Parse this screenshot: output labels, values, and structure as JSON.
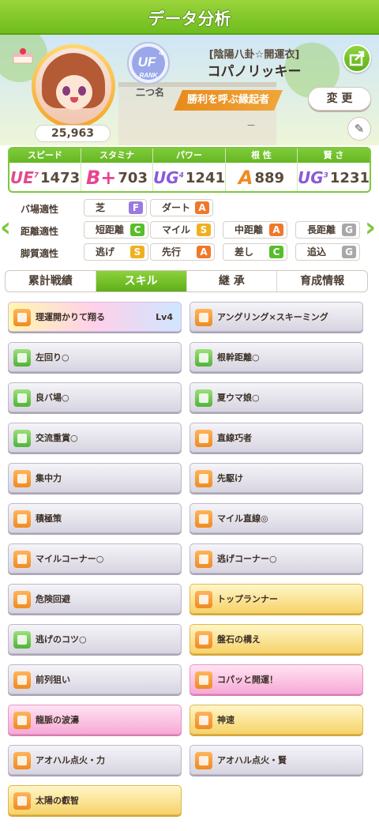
{
  "header": {
    "title": "データ分析"
  },
  "profile": {
    "score": "25,963",
    "rank_label": "RANK",
    "rank_grade": "UF",
    "rank_sub": "4",
    "epithet_label": "二つ名",
    "outfit": "[陰陽八卦☆開運衣]",
    "name": "コパノリッキー",
    "title_badge": "勝利を呼ぶ縁起者",
    "change_label": "変 更",
    "dash": "－"
  },
  "stats": [
    {
      "label": "スピード",
      "grade": "UE",
      "grade_sub": "7",
      "value": "1473",
      "color": "#e04b8a"
    },
    {
      "label": "スタミナ",
      "grade": "B+",
      "grade_sub": "",
      "value": "703",
      "color": "#e8458f"
    },
    {
      "label": "パワー",
      "grade": "UG",
      "grade_sub": "4",
      "value": "1241",
      "color": "#8a5ad8"
    },
    {
      "label": "根 性",
      "grade": "A",
      "grade_sub": "",
      "value": "889",
      "color": "#f08a22"
    },
    {
      "label": "賢 さ",
      "grade": "UG",
      "grade_sub": "3",
      "value": "1231",
      "color": "#8a5ad8"
    }
  ],
  "aptitude": {
    "rows": [
      {
        "label": "バ場適性",
        "items": [
          {
            "name": "芝",
            "grade": "F"
          },
          {
            "name": "ダート",
            "grade": "A"
          }
        ]
      },
      {
        "label": "距離適性",
        "items": [
          {
            "name": "短距離",
            "grade": "C"
          },
          {
            "name": "マイル",
            "grade": "S"
          },
          {
            "name": "中距離",
            "grade": "A"
          },
          {
            "name": "長距離",
            "grade": "G"
          }
        ]
      },
      {
        "label": "脚質適性",
        "items": [
          {
            "name": "逃げ",
            "grade": "S"
          },
          {
            "name": "先行",
            "grade": "A"
          },
          {
            "name": "差し",
            "grade": "C"
          },
          {
            "name": "追込",
            "grade": "G"
          }
        ]
      }
    ],
    "grade_colors": {
      "S": "#f0b01e",
      "A": "#f0782a",
      "C": "#56be2a",
      "F": "#9a7ae0",
      "G": "#a8a8a8"
    }
  },
  "tabs": [
    "累計戦績",
    "スキル",
    "継 承",
    "育成情報"
  ],
  "active_tab": 1,
  "skills": [
    {
      "name": "理運開かりて翔る",
      "level": "Lv4",
      "style": "rainbow",
      "icon": "o"
    },
    {
      "name": "アングリング×スキーミング",
      "level": "",
      "style": "silver",
      "icon": "o"
    },
    {
      "name": "左回り○",
      "level": "",
      "style": "silver",
      "icon": "g"
    },
    {
      "name": "根幹距離○",
      "level": "",
      "style": "silver",
      "icon": "g"
    },
    {
      "name": "良バ場○",
      "level": "",
      "style": "silver",
      "icon": "g"
    },
    {
      "name": "夏ウマ娘○",
      "level": "",
      "style": "silver",
      "icon": "g"
    },
    {
      "name": "交流重賞○",
      "level": "",
      "style": "silver",
      "icon": "g"
    },
    {
      "name": "直線巧者",
      "level": "",
      "style": "silver",
      "icon": "o"
    },
    {
      "name": "集中力",
      "level": "",
      "style": "silver",
      "icon": "o"
    },
    {
      "name": "先駆け",
      "level": "",
      "style": "silver",
      "icon": "o"
    },
    {
      "name": "積極策",
      "level": "",
      "style": "silver",
      "icon": "o"
    },
    {
      "name": "マイル直線◎",
      "level": "",
      "style": "silver",
      "icon": "o"
    },
    {
      "name": "マイルコーナー○",
      "level": "",
      "style": "silver",
      "icon": "o"
    },
    {
      "name": "逃げコーナー○",
      "level": "",
      "style": "silver",
      "icon": "o"
    },
    {
      "name": "危険回避",
      "level": "",
      "style": "silver",
      "icon": "o"
    },
    {
      "name": "トップランナー",
      "level": "",
      "style": "gold",
      "icon": "o"
    },
    {
      "name": "逃げのコツ○",
      "level": "",
      "style": "silver",
      "icon": "g"
    },
    {
      "name": "盤石の構え",
      "level": "",
      "style": "gold",
      "icon": "o"
    },
    {
      "name": "前列狙い",
      "level": "",
      "style": "silver",
      "icon": "o"
    },
    {
      "name": "コパッと開運！",
      "level": "",
      "style": "pink",
      "icon": "o"
    },
    {
      "name": "龍脈の波濤",
      "level": "",
      "style": "pink",
      "icon": "o"
    },
    {
      "name": "神速",
      "level": "",
      "style": "gold",
      "icon": "o"
    },
    {
      "name": "アオハル点火・力",
      "level": "",
      "style": "silver",
      "icon": "o"
    },
    {
      "name": "アオハル点火・賢",
      "level": "",
      "style": "silver",
      "icon": "o"
    },
    {
      "name": "太陽の叡智",
      "level": "",
      "style": "gold",
      "icon": "o"
    }
  ]
}
